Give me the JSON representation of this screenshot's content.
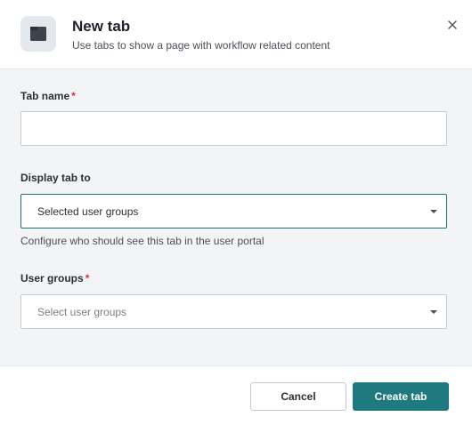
{
  "dialog": {
    "title": "New tab",
    "subtitle": "Use tabs to show a page with workflow related content",
    "icon": "browser-tab-icon",
    "close_icon": "close-icon"
  },
  "form": {
    "tab_name": {
      "label": "Tab name",
      "required_mark": "*",
      "value": ""
    },
    "display_tab_to": {
      "label": "Display tab to",
      "selected": "Selected user groups",
      "hint": "Configure who should see this tab in the user portal"
    },
    "user_groups": {
      "label": "User groups",
      "required_mark": "*",
      "placeholder": "Select user groups"
    }
  },
  "footer": {
    "cancel_label": "Cancel",
    "create_label": "Create tab"
  },
  "colors": {
    "primary": "#1f7a80",
    "required": "#d6323a",
    "panel_bg": "#f3f4f6"
  }
}
